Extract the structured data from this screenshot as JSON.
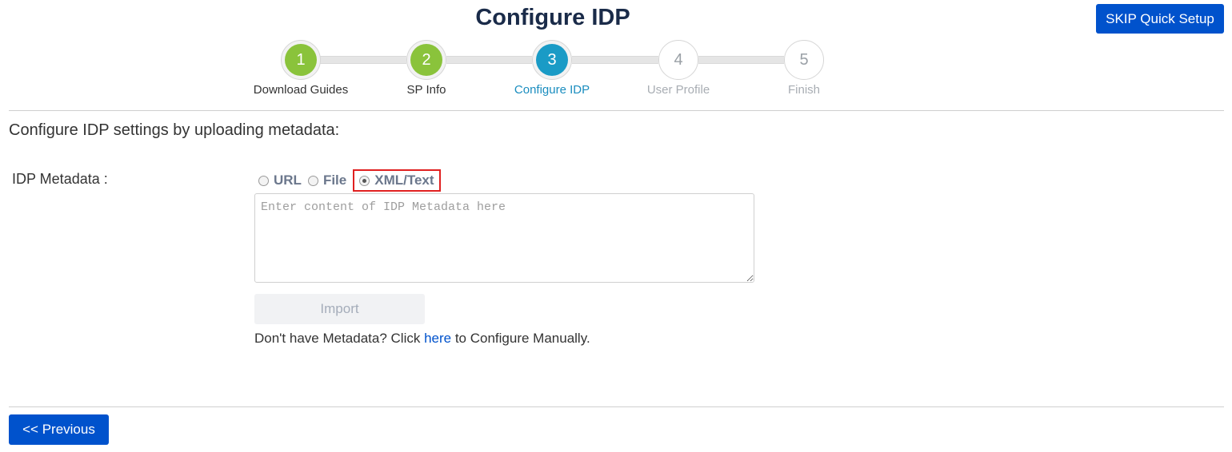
{
  "header": {
    "title": "Configure IDP",
    "skip_label": "SKIP Quick Setup"
  },
  "stepper": {
    "steps": [
      {
        "number": "1",
        "label": "Download Guides",
        "state": "done"
      },
      {
        "number": "2",
        "label": "SP Info",
        "state": "done"
      },
      {
        "number": "3",
        "label": "Configure IDP",
        "state": "active"
      },
      {
        "number": "4",
        "label": "User Profile",
        "state": "todo"
      },
      {
        "number": "5",
        "label": "Finish",
        "state": "todo"
      }
    ],
    "colors": {
      "done": "#8ac33b",
      "active": "#1a9bc6",
      "todo": "#a8adb3"
    }
  },
  "form": {
    "heading": "Configure IDP settings by uploading metadata:",
    "metadata_label": "IDP Metadata :",
    "options": [
      {
        "label": "URL",
        "checked": false
      },
      {
        "label": "File",
        "checked": false
      },
      {
        "label": "XML/Text",
        "checked": true
      }
    ],
    "textarea_value": "",
    "textarea_placeholder": "Enter content of IDP Metadata here",
    "import_label": "Import",
    "manual_prefix": "Don't have Metadata? Click ",
    "manual_link": "here",
    "manual_suffix": " to Configure Manually."
  },
  "footer": {
    "previous_label": "<< Previous"
  },
  "colors": {
    "primary": "#0052cc",
    "highlight": "#e02020"
  }
}
